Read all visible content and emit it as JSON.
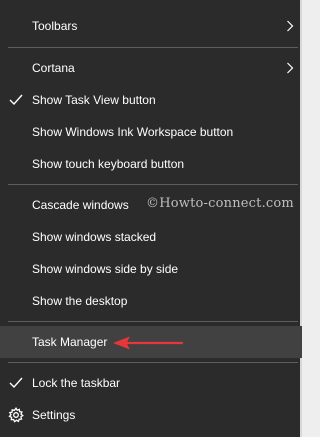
{
  "menu": {
    "toolbars_label": "Toolbars",
    "cortana_label": "Cortana",
    "show_task_view_label": "Show Task View button",
    "show_ink_workspace_label": "Show Windows Ink Workspace button",
    "show_touch_keyboard_label": "Show touch keyboard button",
    "cascade_label": "Cascade windows",
    "stacked_label": "Show windows stacked",
    "side_by_side_label": "Show windows side by side",
    "show_desktop_label": "Show the desktop",
    "task_manager_label": "Task Manager",
    "lock_taskbar_label": "Lock the taskbar",
    "settings_label": "Settings"
  },
  "watermark": "©Howto-connect.com",
  "icons": {
    "submenu": "chevron-right-icon",
    "checked": "checkmark-icon",
    "settings": "gear-icon",
    "annotation": "red-arrow-icon"
  },
  "colors": {
    "menu_background": "#2b2b2b",
    "highlight": "#414141",
    "text": "#ffffff",
    "separator": "#5e5e5e",
    "arrow": "#e8363a"
  }
}
